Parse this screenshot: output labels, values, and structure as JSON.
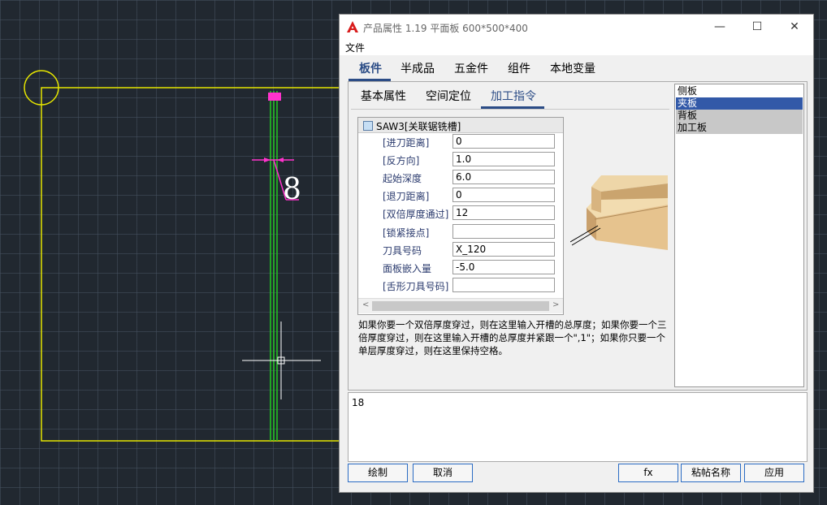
{
  "cad": {
    "dimension_text": "8",
    "colors": {
      "background": "#212830",
      "outline": "#e6e600",
      "groove": "#22cc22",
      "dimension": "#ff33cc",
      "cursor": "#ffffff"
    }
  },
  "dialog": {
    "title": "产品属性 1.19 平面板 600*500*400",
    "window_controls": {
      "minimize": "—",
      "maximize": "☐",
      "close": "✕"
    },
    "menu": {
      "file": "文件"
    },
    "main_tabs": [
      "板件",
      "半成品",
      "五金件",
      "组件",
      "本地变量"
    ],
    "main_tab_active": "板件",
    "sub_tabs": [
      "基本属性",
      "空间定位",
      "加工指令"
    ],
    "sub_tab_active": "加工指令",
    "command": {
      "header": "SAW3[关联锯铣槽]",
      "properties": [
        {
          "label": "[进刀距离]",
          "value": "0"
        },
        {
          "label": "[反方向]",
          "value": "1.0"
        },
        {
          "label": "起始深度",
          "value": "6.0"
        },
        {
          "label": "[退刀距离]",
          "value": "0"
        },
        {
          "label": "[双倍厚度通过]",
          "value": "12"
        },
        {
          "label": "[锁紧接点]",
          "value": ""
        },
        {
          "label": "刀具号码",
          "value": "X_120"
        },
        {
          "label": "面板嵌入量",
          "value": "-5.0"
        },
        {
          "label": "[舌形刀具号码]",
          "value": ""
        }
      ],
      "scroll_left": "<",
      "scroll_right": ">"
    },
    "help_text": "如果你要一个双倍厚度穿过，则在这里输入开槽的总厚度；如果你要一个三倍厚度穿过，则在这里输入开槽的总厚度并紧跟一个\",1\"；如果你只要一个单层厚度穿过，则在这里保持空格。",
    "panel_list": [
      "侧板",
      "夹板",
      "背板",
      "加工板"
    ],
    "panel_list_selected": "夹板",
    "output_value": "18",
    "buttons": {
      "draw": "绘制",
      "cancel": "取消",
      "fx": "fx",
      "paste_name": "粘帖名称",
      "apply": "应用"
    },
    "colors": {
      "accent": "#2b4c86",
      "selection": "#3259a8",
      "list_highlight": "#c8c8c8",
      "button_border": "#2b6cc4"
    }
  }
}
